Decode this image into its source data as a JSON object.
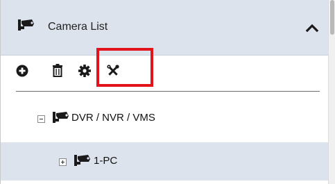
{
  "panel": {
    "title": "Camera List",
    "header_icon": "camera-icon",
    "collapse_icon": "chevron-up-icon"
  },
  "toolbar": {
    "tools": [
      {
        "name": "add",
        "icon": "plus-circle-icon"
      },
      {
        "name": "delete",
        "icon": "trash-icon"
      },
      {
        "name": "settings",
        "icon": "gear-icon"
      },
      {
        "name": "tools",
        "icon": "tools-icon"
      }
    ],
    "highlighted_tool": "tools"
  },
  "tree": {
    "nodes": [
      {
        "label": "DVR / NVR / VMS",
        "icon": "camera-icon",
        "expander": "collapse",
        "level": 1
      },
      {
        "label": "1-PC",
        "icon": "camera-icon",
        "expander": "expand",
        "level": 2,
        "selected": true
      }
    ]
  },
  "colors": {
    "header_bg": "#dde3ec",
    "selected_row_bg": "#dde3ec",
    "highlight_border": "#e3131b",
    "icon_color": "#1a1a1a"
  }
}
